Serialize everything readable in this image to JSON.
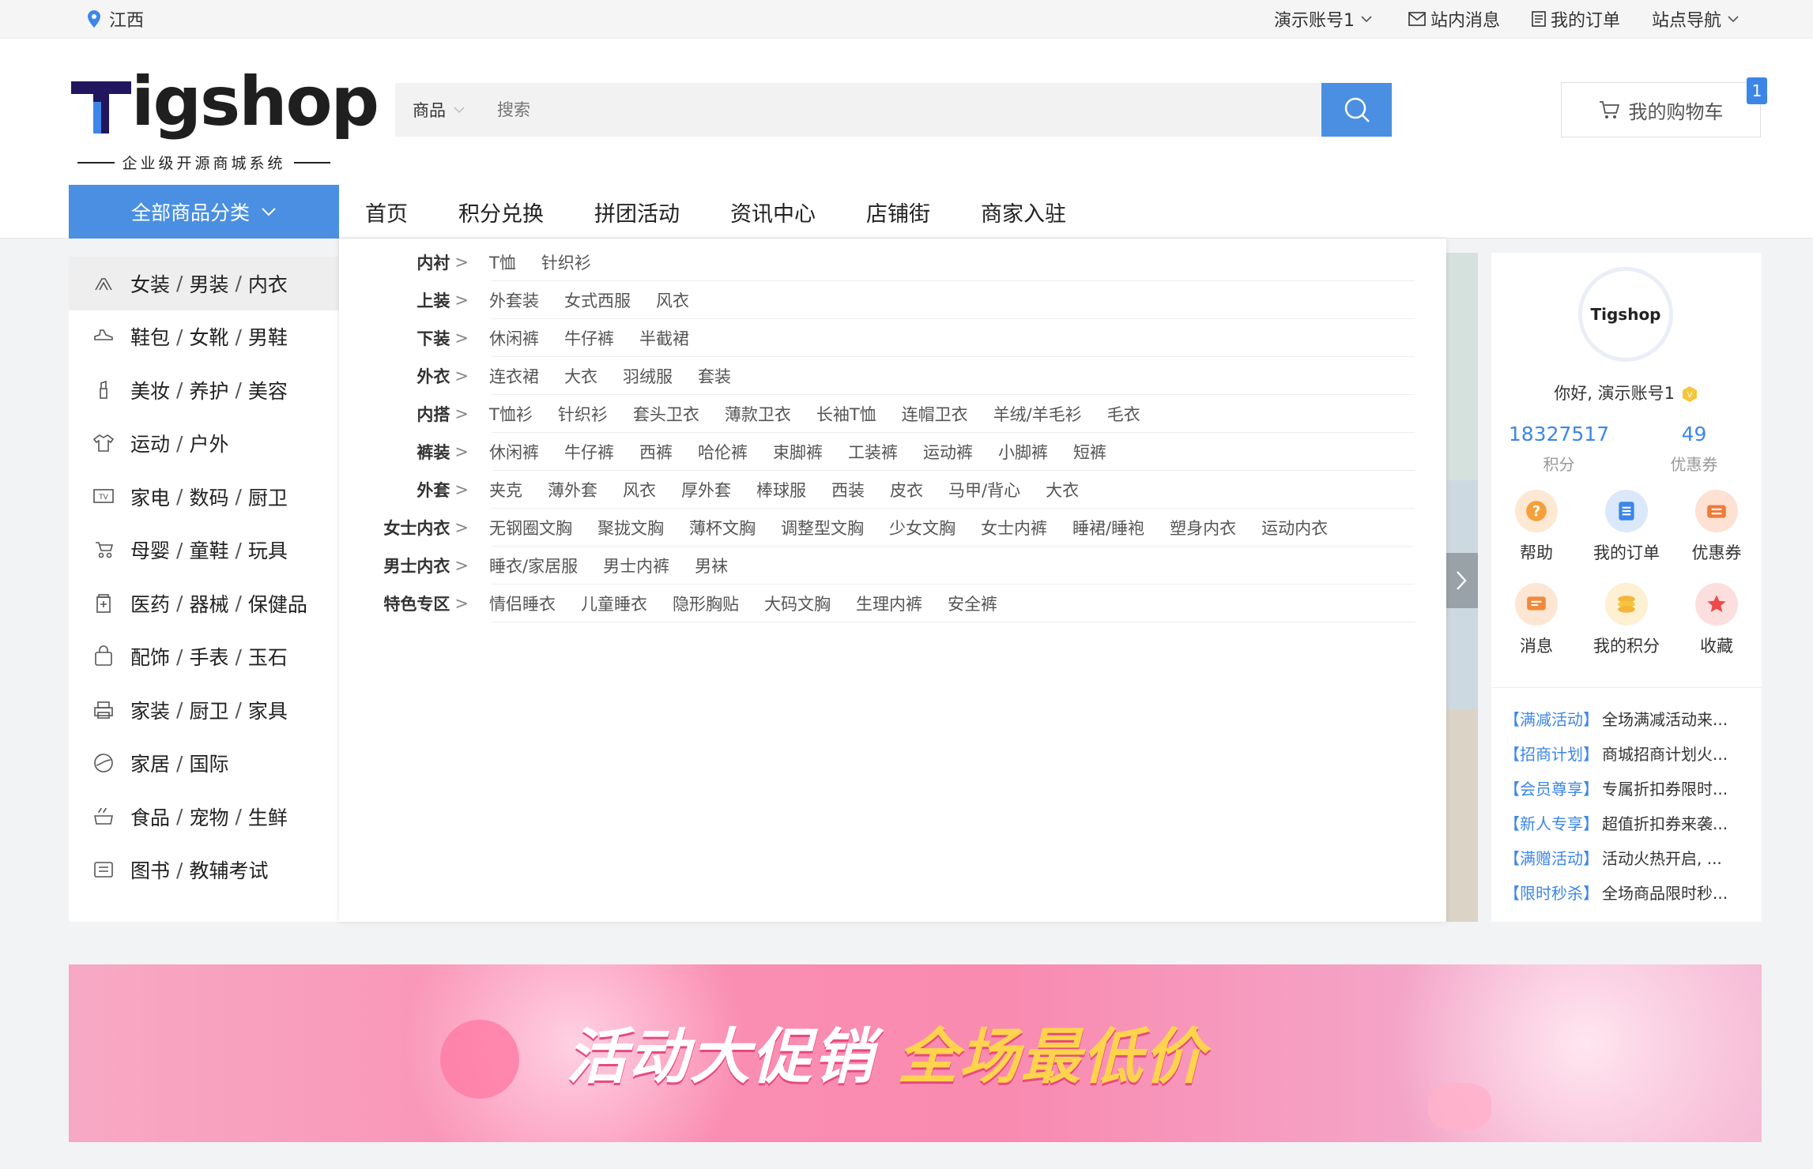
{
  "topbar": {
    "location": "江西",
    "account": "演示账号1",
    "messages": "站内消息",
    "orders": "我的订单",
    "site_nav": "站点导航"
  },
  "header": {
    "logo_text": "igshop",
    "logo_sub": "企业级开源商城系统",
    "search_category": "商品",
    "search_placeholder": "搜索",
    "cart_label": "我的购物车",
    "cart_count": "1"
  },
  "nav": {
    "all_categories": "全部商品分类",
    "items": [
      "首页",
      "积分兑换",
      "拼团活动",
      "资讯中心",
      "店铺街",
      "商家入驻"
    ]
  },
  "sidebar": {
    "items": [
      {
        "icon": "clothes-icon",
        "parts": [
          "女装",
          "男装",
          "内衣"
        ]
      },
      {
        "icon": "shoe-icon",
        "parts": [
          "鞋包",
          "女靴",
          "男鞋"
        ]
      },
      {
        "icon": "lipstick-icon",
        "parts": [
          "美妆",
          "养护",
          "美容"
        ]
      },
      {
        "icon": "tshirt-icon",
        "parts": [
          "运动",
          "户外"
        ]
      },
      {
        "icon": "tv-icon",
        "parts": [
          "家电",
          "数码",
          "厨卫"
        ]
      },
      {
        "icon": "stroller-icon",
        "parts": [
          "母婴",
          "童鞋",
          "玩具"
        ]
      },
      {
        "icon": "medicine-icon",
        "parts": [
          "医药",
          "器械",
          "保健品"
        ]
      },
      {
        "icon": "bag-icon",
        "parts": [
          "配饰",
          "手表",
          "玉石"
        ]
      },
      {
        "icon": "printer-icon",
        "parts": [
          "家装",
          "厨卫",
          "家具"
        ]
      },
      {
        "icon": "globe-icon",
        "parts": [
          "家居",
          "国际"
        ]
      },
      {
        "icon": "food-icon",
        "parts": [
          "食品",
          "宠物",
          "生鲜"
        ]
      },
      {
        "icon": "book-icon",
        "parts": [
          "图书",
          "教辅考试"
        ]
      }
    ]
  },
  "mega_menu": {
    "rows": [
      {
        "label": "内衬",
        "values": [
          "T恤",
          "针织衫"
        ]
      },
      {
        "label": "上装",
        "values": [
          "外套装",
          "女式西服",
          "风衣"
        ]
      },
      {
        "label": "下装",
        "values": [
          "休闲裤",
          "牛仔裤",
          "半截裙"
        ]
      },
      {
        "label": "外衣",
        "values": [
          "连衣裙",
          "大衣",
          "羽绒服",
          "套装"
        ]
      },
      {
        "label": "内搭",
        "values": [
          "T恤衫",
          "针织衫",
          "套头卫衣",
          "薄款卫衣",
          "长袖T恤",
          "连帽卫衣",
          "羊绒/羊毛衫",
          "毛衣"
        ]
      },
      {
        "label": "裤装",
        "values": [
          "休闲裤",
          "牛仔裤",
          "西裤",
          "哈伦裤",
          "束脚裤",
          "工装裤",
          "运动裤",
          "小脚裤",
          "短裤"
        ]
      },
      {
        "label": "外套",
        "values": [
          "夹克",
          "薄外套",
          "风衣",
          "厚外套",
          "棒球服",
          "西装",
          "皮衣",
          "马甲/背心",
          "大衣"
        ]
      },
      {
        "label": "女士内衣",
        "values": [
          "无钢圈文胸",
          "聚拢文胸",
          "薄杯文胸",
          "调整型文胸",
          "少女文胸",
          "女士内裤",
          "睡裙/睡袍",
          "塑身内衣",
          "运动内衣"
        ]
      },
      {
        "label": "男士内衣",
        "values": [
          "睡衣/家居服",
          "男士内裤",
          "男袜"
        ]
      },
      {
        "label": "特色专区",
        "values": [
          "情侣睡衣",
          "儿童睡衣",
          "隐形胸贴",
          "大码文胸",
          "生理内裤",
          "安全裤"
        ]
      }
    ]
  },
  "user_panel": {
    "avatar_text": "Tigshop",
    "greeting": "你好, 演示账号1",
    "points_value": "18327517",
    "points_label": "积分",
    "coupons_value": "49",
    "coupons_label": "优惠券",
    "shortcuts": [
      {
        "label": "帮助",
        "icon": "help-icon",
        "color": "#f5a03a"
      },
      {
        "label": "我的订单",
        "icon": "order-icon",
        "color": "#3d86e8"
      },
      {
        "label": "优惠券",
        "icon": "coupon-icon",
        "color": "#f07a3a"
      },
      {
        "label": "消息",
        "icon": "message-icon",
        "color": "#f08a3a"
      },
      {
        "label": "我的积分",
        "icon": "coins-icon",
        "color": "#f5b43a"
      },
      {
        "label": "收藏",
        "icon": "star-icon",
        "color": "#ef4a4a"
      }
    ],
    "news": [
      {
        "tag": "【满减活动】",
        "text": "全场满减活动来..."
      },
      {
        "tag": "【招商计划】",
        "text": "商城招商计划火..."
      },
      {
        "tag": "【会员尊享】",
        "text": "专属折扣券限时..."
      },
      {
        "tag": "【新人专享】",
        "text": "超值折扣券来袭..."
      },
      {
        "tag": "【满赠活动】",
        "text": "活动火热开启, ..."
      },
      {
        "tag": "【限时秒杀】",
        "text": "全场商品限时秒..."
      }
    ]
  },
  "banner": {
    "text_white": "活动大促销",
    "text_yellow": "全场最低价"
  }
}
